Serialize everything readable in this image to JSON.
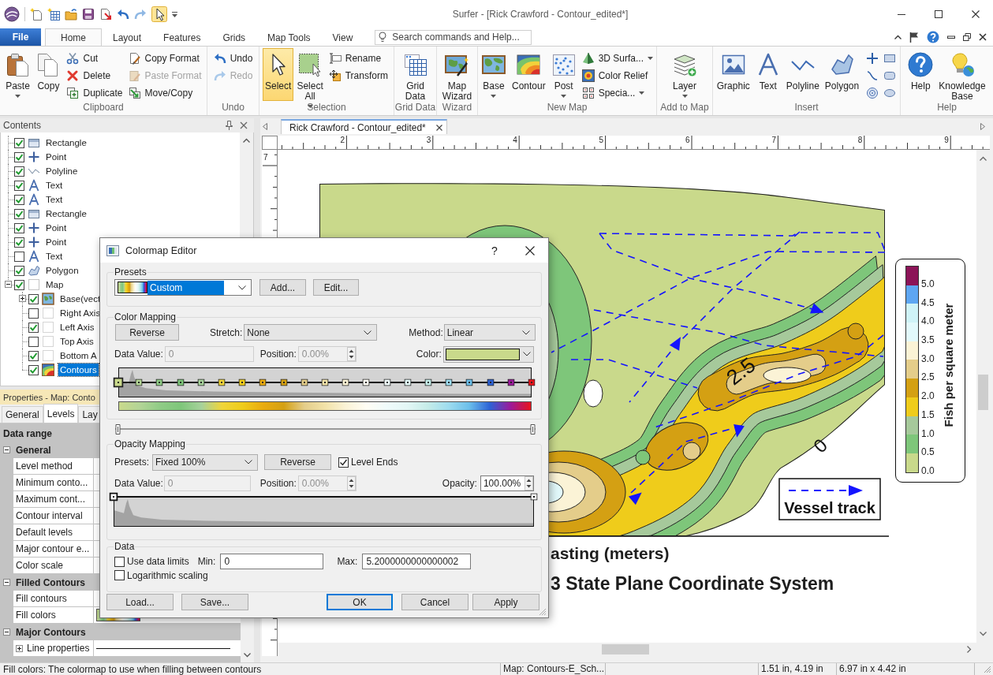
{
  "window": {
    "title": "Surfer - [Rick Crawford - Contour_edited*]"
  },
  "ribbon": {
    "file_tab": "File",
    "tabs": [
      {
        "label": "Home",
        "selected": true
      },
      {
        "label": "Layout",
        "selected": false
      },
      {
        "label": "Features",
        "selected": false
      },
      {
        "label": "Grids",
        "selected": false
      },
      {
        "label": "Map Tools",
        "selected": false
      },
      {
        "label": "View",
        "selected": false
      }
    ],
    "search": {
      "placeholder": "Search commands and Help..."
    },
    "groups": [
      {
        "label": "Clipboard",
        "large": [
          {
            "label": "Paste",
            "menu": true,
            "selected": false
          },
          {
            "label": "Copy",
            "menu": false,
            "selected": false
          }
        ],
        "small": [
          {
            "label": "Cut",
            "menu": false,
            "disabled": false
          },
          {
            "label": "Delete",
            "menu": false,
            "disabled": false
          },
          {
            "label": "Duplicate",
            "menu": false,
            "disabled": false
          },
          {
            "label": "Copy Format",
            "menu": false,
            "disabled": false
          },
          {
            "label": "Paste Format",
            "menu": false,
            "disabled": true
          },
          {
            "label": "Move/Copy",
            "menu": false,
            "disabled": false
          }
        ]
      },
      {
        "label": "Undo",
        "small": [
          {
            "label": "Undo",
            "menu": false,
            "disabled": false
          },
          {
            "label": "Redo",
            "menu": false,
            "disabled": true
          }
        ]
      },
      {
        "label": "Selection",
        "large": [
          {
            "label": "Select",
            "menu": false,
            "selected": true
          },
          {
            "label": "Select All",
            "menu": true,
            "selected": false
          }
        ],
        "small": [
          {
            "label": "Rename",
            "menu": false,
            "disabled": false
          },
          {
            "label": "Transform",
            "menu": false,
            "disabled": false
          }
        ]
      },
      {
        "label": "Grid Data",
        "large": [
          {
            "label": "Grid Data",
            "menu": false,
            "selected": false
          }
        ]
      },
      {
        "label": "Wizard",
        "large": [
          {
            "label": "Map Wizard",
            "menu": false,
            "selected": false
          }
        ]
      },
      {
        "label": "New Map",
        "large": [
          {
            "label": "Base",
            "menu": true,
            "selected": false
          },
          {
            "label": "Contour",
            "menu": false,
            "selected": false
          },
          {
            "label": "Post",
            "menu": true,
            "selected": false
          }
        ],
        "small": [
          {
            "label": "3D Surfa...",
            "menu": true,
            "disabled": false
          },
          {
            "label": "Color Relief",
            "menu": false,
            "disabled": false
          },
          {
            "label": "Specia...",
            "menu": true,
            "disabled": false
          }
        ]
      },
      {
        "label": "Add to Map",
        "large": [
          {
            "label": "Layer",
            "menu": true,
            "selected": false
          }
        ]
      },
      {
        "label": "Insert",
        "large": [
          {
            "label": "Graphic",
            "menu": false,
            "selected": false
          },
          {
            "label": "Text",
            "menu": false,
            "selected": false
          },
          {
            "label": "Polyline",
            "menu": false,
            "selected": false
          },
          {
            "label": "Polygon",
            "menu": false,
            "selected": false
          }
        ]
      },
      {
        "label": "Help",
        "large": [
          {
            "label": "Help",
            "menu": false,
            "selected": false
          },
          {
            "label": "Knowledge Base",
            "menu": false,
            "selected": false
          }
        ]
      }
    ]
  },
  "contents": {
    "title": "Contents",
    "items": [
      {
        "label": "Rectangle",
        "kind": "rectangle",
        "checked": true,
        "selected": false
      },
      {
        "label": "Point",
        "kind": "point",
        "checked": true,
        "selected": false
      },
      {
        "label": "Polyline",
        "kind": "polyline",
        "checked": true,
        "selected": false
      },
      {
        "label": "Text",
        "kind": "text",
        "checked": true,
        "selected": false
      },
      {
        "label": "Text",
        "kind": "text",
        "checked": true,
        "selected": false
      },
      {
        "label": "Rectangle",
        "kind": "rectangle",
        "checked": true,
        "selected": false
      },
      {
        "label": "Point",
        "kind": "point",
        "checked": true,
        "selected": false
      },
      {
        "label": "Point",
        "kind": "point",
        "checked": true,
        "selected": false
      },
      {
        "label": "Text",
        "kind": "text",
        "checked": false,
        "selected": false
      },
      {
        "label": "Polygon",
        "kind": "polygon",
        "checked": true,
        "selected": false
      },
      {
        "label": "Map",
        "kind": "map",
        "checked": true,
        "selected": false,
        "expanded": true,
        "children": [
          {
            "label": "Base(vect",
            "kind": "base",
            "checked": true,
            "selected": false,
            "expanded": false
          },
          {
            "label": "Right Axis",
            "kind": "axis",
            "checked": false,
            "selected": false
          },
          {
            "label": "Left Axis",
            "kind": "axis",
            "checked": true,
            "selected": false
          },
          {
            "label": "Top Axis",
            "kind": "axis",
            "checked": false,
            "selected": false
          },
          {
            "label": "Bottom A",
            "kind": "axis",
            "checked": true,
            "selected": false
          },
          {
            "label": "Contours",
            "kind": "contours",
            "checked": true,
            "selected": true
          }
        ]
      }
    ]
  },
  "properties": {
    "title": "Properties - Map: Conto",
    "tabs": [
      {
        "label": "General",
        "selected": false
      },
      {
        "label": "Levels",
        "selected": true
      },
      {
        "label": "Lay",
        "selected": false
      }
    ],
    "rows": [
      {
        "kind": "category",
        "label": "Data range"
      },
      {
        "kind": "section",
        "label": "General",
        "expanded": true
      },
      {
        "kind": "property",
        "label": "Level method"
      },
      {
        "kind": "property",
        "label": "Minimum conto..."
      },
      {
        "kind": "property",
        "label": "Maximum cont..."
      },
      {
        "kind": "property",
        "label": "Contour interval"
      },
      {
        "kind": "property",
        "label": "Default levels"
      },
      {
        "kind": "property",
        "label": "Major contour e..."
      },
      {
        "kind": "property",
        "label": "Color scale"
      },
      {
        "kind": "section",
        "label": "Filled Contours",
        "expanded": true
      },
      {
        "kind": "property",
        "label": "Fill contours"
      },
      {
        "kind": "colormap",
        "label": "Fill colors"
      },
      {
        "kind": "section",
        "label": "Major Contours",
        "expanded": true
      },
      {
        "kind": "line",
        "label": "Line properties",
        "expanded": false
      }
    ]
  },
  "document": {
    "tabs": [
      {
        "label": "Rick Crawford - Contour_edited*",
        "selected": true
      }
    ],
    "ruler": {
      "horizontal": [
        "2",
        "3",
        "4",
        "5",
        "6",
        "7",
        "8",
        "9"
      ],
      "vertical": [
        "7"
      ]
    },
    "map": {
      "contour_labels": [
        "2.5",
        "0"
      ],
      "legend": {
        "label": "Vessel track"
      },
      "color_scale": {
        "title": "Fish per square meter",
        "bands": [
          {
            "label": "5.0",
            "color": "#8c1458"
          },
          {
            "label": "4.5",
            "color": "#5ea6f2"
          },
          {
            "label": "4.0",
            "color": "#cff3f7"
          },
          {
            "label": "3.5",
            "color": "#e2f9fb"
          },
          {
            "label": "3.0",
            "color": "#fbf3d6"
          },
          {
            "label": "2.5",
            "color": "#e4cd8a"
          },
          {
            "label": "2.0",
            "color": "#d4a013"
          },
          {
            "label": "1.5",
            "color": "#efcc1b"
          },
          {
            "label": "1.0",
            "color": "#a6c99b"
          },
          {
            "label": "0.5",
            "color": "#7ec67a"
          },
          {
            "label": "0.0",
            "color": "#c9d98b"
          }
        ]
      },
      "axis_title": "asting (meters)",
      "subtitle": "3 State Plane Coordinate System"
    }
  },
  "dialog": {
    "title": "Colormap Editor",
    "help": "?",
    "presets": {
      "label": "Presets",
      "value": "Custom",
      "buttons": [
        {
          "label": "Add..."
        },
        {
          "label": "Edit..."
        }
      ]
    },
    "color_mapping": {
      "label": "Color Mapping",
      "reverse": "Reverse",
      "stretch": {
        "label": "Stretch:",
        "value": "None"
      },
      "method": {
        "label": "Method:",
        "value": "Linear"
      },
      "data_value": {
        "label": "Data Value:",
        "value": "0",
        "disabled": true
      },
      "position": {
        "label": "Position:",
        "value": "0.00%",
        "disabled": true
      },
      "color": {
        "label": "Color:",
        "color": "#c9d98b"
      },
      "nodes": [
        {
          "color": "#c9d98b",
          "selected": true
        },
        {
          "color": "#b3d496",
          "selected": false
        },
        {
          "color": "#8fcb86",
          "selected": false
        },
        {
          "color": "#7ec67a",
          "selected": false
        },
        {
          "color": "#a6d19b",
          "selected": false
        },
        {
          "color": "#f0d53a",
          "selected": false
        },
        {
          "color": "#efcc1b",
          "selected": false
        },
        {
          "color": "#e9ab10",
          "selected": false
        },
        {
          "color": "#d4a013",
          "selected": false
        },
        {
          "color": "#e4cd8a",
          "selected": false
        },
        {
          "color": "#f2e2a8",
          "selected": false
        },
        {
          "color": "#fbf3d6",
          "selected": false
        },
        {
          "color": "#fffdf4",
          "selected": false
        },
        {
          "color": "#f0fbfb",
          "selected": false
        },
        {
          "color": "#e3f7f6",
          "selected": false
        },
        {
          "color": "#c5ece8",
          "selected": false
        },
        {
          "color": "#9edcef",
          "selected": false
        },
        {
          "color": "#6cbfea",
          "selected": false
        },
        {
          "color": "#2d63d6",
          "selected": false
        },
        {
          "color": "#9b1b9b",
          "selected": false
        },
        {
          "color": "#e8141c",
          "selected": false
        }
      ]
    },
    "opacity_mapping": {
      "label": "Opacity Mapping",
      "presets": {
        "label": "Presets:",
        "value": "Fixed 100%"
      },
      "reverse": "Reverse",
      "level_ends": {
        "label": "Level Ends",
        "checked": true
      },
      "data_value": {
        "label": "Data Value:",
        "value": "0",
        "disabled": true
      },
      "position": {
        "label": "Position:",
        "value": "0.00%",
        "disabled": true
      },
      "opacity": {
        "label": "Opacity:",
        "value": "100.00%",
        "disabled": false
      },
      "nodes": [
        {
          "selected": true
        },
        {
          "selected": false
        }
      ]
    },
    "data": {
      "label": "Data",
      "use_data_limits": {
        "label": "Use data limits",
        "checked": false
      },
      "min": {
        "label": "Min:",
        "value": "0"
      },
      "max": {
        "label": "Max:",
        "value": "5.2000000000000002"
      },
      "logarithmic": {
        "label": "Logarithmic scaling",
        "checked": false
      }
    },
    "buttons": [
      {
        "label": "Load...",
        "default": false
      },
      {
        "label": "Save...",
        "default": false
      },
      {
        "label": "OK",
        "default": true
      },
      {
        "label": "Cancel",
        "default": false
      },
      {
        "label": "Apply",
        "default": false
      }
    ]
  },
  "status_bar": {
    "message": "Fill colors: The colormap to use when filling between contours",
    "fields": [
      "Map: Contours-E_Sch...",
      "1.51 in, 4.19 in",
      "6.97 in x 4.42 in"
    ]
  }
}
